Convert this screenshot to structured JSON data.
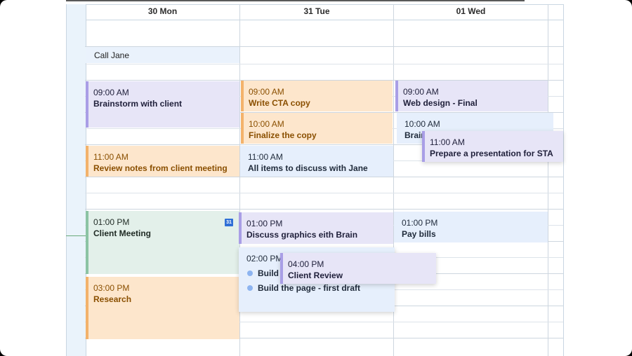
{
  "days": [
    {
      "label": "30 Mon"
    },
    {
      "label": "31 Tue"
    },
    {
      "label": "01 Wed"
    }
  ],
  "all_day": {
    "label": "Call Jane"
  },
  "events": {
    "mon_brainstorm": {
      "time": "09:00 AM",
      "title": "Brainstorm with client"
    },
    "mon_review_notes": {
      "time": "11:00 AM",
      "title": "Review notes from client meeting"
    },
    "mon_client_meeting": {
      "time": "01:00 PM",
      "title": "Client Meeting",
      "icon_text": "31"
    },
    "mon_research": {
      "time": "03:00 PM",
      "title": "Research"
    },
    "tue_write_cta": {
      "time": "09:00 AM",
      "title": "Write CTA copy"
    },
    "tue_finalize": {
      "time": "10:00 AM",
      "title": "Finalize the copy"
    },
    "tue_all_items": {
      "time": "11:00 AM",
      "title": "All items to discuss with Jane"
    },
    "tue_discuss_graphics": {
      "time": "01:00 PM",
      "title": "Discuss graphics eith Brain"
    },
    "tue_build": {
      "time": "02:00 PM",
      "tasks": [
        "Build",
        "Build the page - first draft"
      ]
    },
    "tue_client_review": {
      "time": "04:00 PM",
      "title": "Client Review"
    },
    "wed_web_design": {
      "time": "09:00 AM",
      "title": "Web design - Final"
    },
    "wed_brain": {
      "time": "10:00 AM",
      "title": "Brain"
    },
    "wed_presentation": {
      "time": "11:00 AM",
      "title": "Prepare a presentation for STA"
    },
    "wed_pay_bills": {
      "time": "01:00 PM",
      "title": "Pay bills"
    }
  },
  "colors": {
    "purple": "#e7e5f7",
    "orange": "#fde6cc",
    "blue": "#e6effc",
    "green": "#e3f0ea"
  }
}
